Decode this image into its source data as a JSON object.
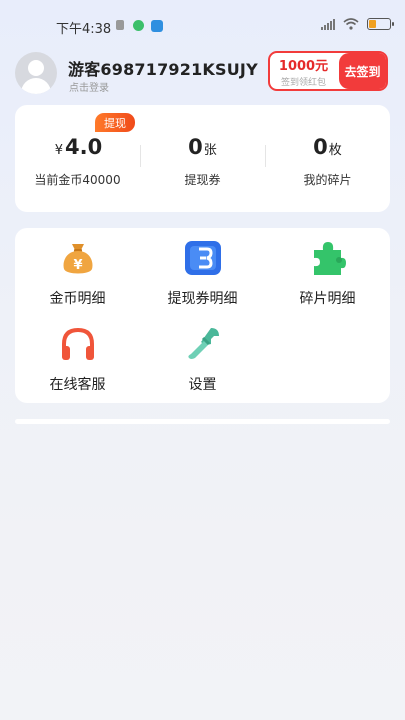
{
  "status_bar": {
    "time": "下午4:38"
  },
  "profile": {
    "username": "游客698717921KSUJY",
    "login_hint": "点击登录",
    "avatar_icon": "avatar-icon"
  },
  "signin": {
    "amount": "1000元",
    "sub": "签到领红包",
    "button": "去签到",
    "color": "#f23b3b"
  },
  "wallet": {
    "withdraw_tag": "提现",
    "currency": "¥",
    "cash_value": "4.0",
    "cash_label": "当前金币40000",
    "coupon_value": "0",
    "coupon_unit": "张",
    "coupon_label": "提现券",
    "fragment_value": "0",
    "fragment_unit": "枚",
    "fragment_label": "我的碎片"
  },
  "menu": {
    "items": [
      {
        "label": "金币明细",
        "icon": "money-bag-icon"
      },
      {
        "label": "提现券明细",
        "icon": "ticket-icon"
      },
      {
        "label": "碎片明细",
        "icon": "puzzle-piece-icon"
      },
      {
        "label": "在线客服",
        "icon": "headphones-icon"
      },
      {
        "label": "设置",
        "icon": "wrench-icon"
      }
    ]
  },
  "colors": {
    "accent_red": "#f23b3b",
    "orange": "#f0a540",
    "blue": "#2f6fe8",
    "green": "#34c46a",
    "teal": "#4bb89a"
  }
}
